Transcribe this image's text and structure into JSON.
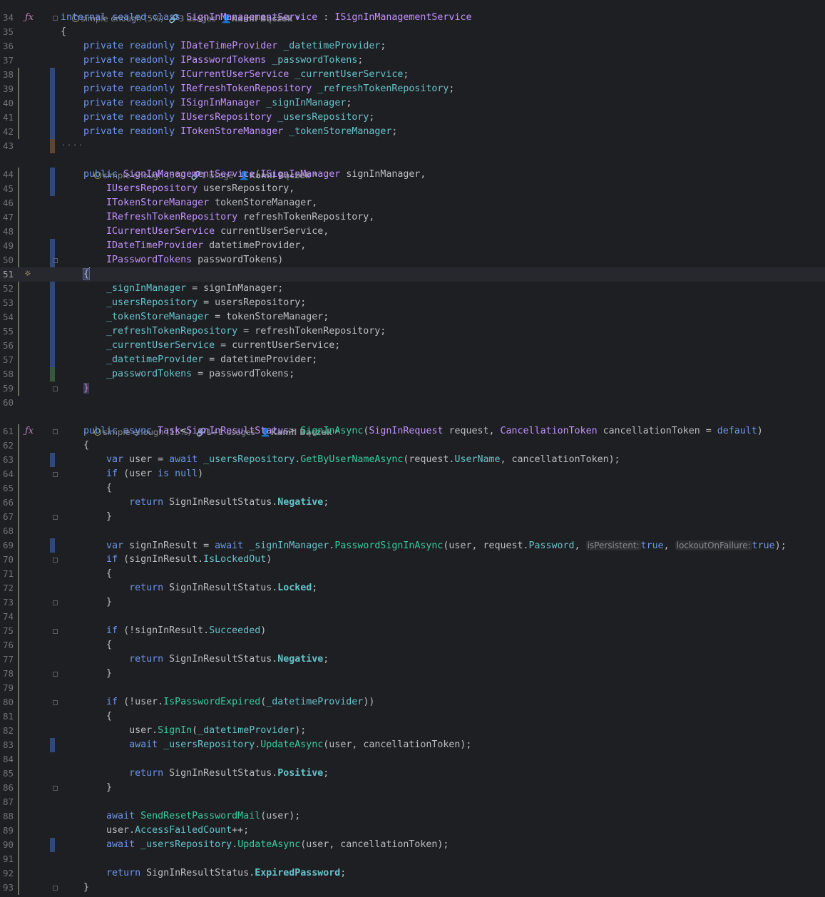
{
  "hints": {
    "class": {
      "complexity": "simple enough (5%)",
      "usages": "3 usages",
      "author": "Kamil Bączek *"
    },
    "ctor": {
      "complexity": "simple enough (5%)",
      "usages": "1 usage",
      "author": "Kamil Bączek *"
    },
    "signin": {
      "complexity": "simple enough (15%)",
      "usages": "1+1 usages",
      "author": "Kamil Bączek *"
    }
  },
  "lines": [
    {
      "n": "34",
      "html": "<span class='kw2'>internal</span> <span class='kw2'>sealed</span> <span class='kw2'>class</span> <span class='ty'>SignInManagementService</span> : <span class='ty'>ISignInManagementService</span>"
    },
    {
      "n": "35",
      "html": "{"
    },
    {
      "n": "36",
      "html": "    <span class='kw2'>private</span> <span class='kw2'>readonly</span> <span class='ty'>IDateTimeProvider</span> <span class='fld'>_datetimeProvider</span>;"
    },
    {
      "n": "37",
      "html": "    <span class='kw2'>private</span> <span class='kw2'>readonly</span> <span class='ty'>IPasswordTokens</span> <span class='fld'>_passwordTokens</span>;"
    },
    {
      "n": "38",
      "html": "    <span class='kw2'>private</span> <span class='kw2'>readonly</span> <span class='ty'>ICurrentUserService</span> <span class='fld'>_currentUserService</span>;"
    },
    {
      "n": "39",
      "html": "    <span class='kw2'>private</span> <span class='kw2'>readonly</span> <span class='ty'>IRefreshTokenRepository</span> <span class='fld'>_refreshTokenRepository</span>;"
    },
    {
      "n": "40",
      "html": "    <span class='kw2'>private</span> <span class='kw2'>readonly</span> <span class='ty'>ISignInManager</span> <span class='fld'>_signInManager</span>;"
    },
    {
      "n": "41",
      "html": "    <span class='kw2'>private</span> <span class='kw2'>readonly</span> <span class='ty'>IUsersRepository</span> <span class='fld'>_usersRepository</span>;"
    },
    {
      "n": "42",
      "html": "    <span class='kw2'>private</span> <span class='kw2'>readonly</span> <span class='ty'>ITokenStoreManager</span> <span class='fld'>_tokenStoreManager</span>;"
    },
    {
      "n": "43",
      "html": "<span class='dots'>····</span>"
    },
    {
      "n": "44",
      "html": "    <span class='kw2'>public</span> <span class='ty'>SignInManagementService</span>(<span class='ty'>ISignInManager</span> signInManager,"
    },
    {
      "n": "45",
      "html": "        <span class='ty'>IUsersRepository</span> usersRepository,"
    },
    {
      "n": "46",
      "html": "        <span class='ty'>ITokenStoreManager</span> tokenStoreManager,"
    },
    {
      "n": "47",
      "html": "        <span class='ty'>IRefreshTokenRepository</span> refreshTokenRepository,"
    },
    {
      "n": "48",
      "html": "        <span class='ty'>ICurrentUserService</span> currentUserService,"
    },
    {
      "n": "49",
      "html": "        <span class='ty'>IDateTimeProvider</span> datetimeProvider,"
    },
    {
      "n": "50",
      "html": "        <span class='ty'>IPasswordTokens</span> passwordTokens)"
    },
    {
      "n": "51",
      "html": "    <span class='brace-hl'>{</span><span class='caret'></span>"
    },
    {
      "n": "52",
      "html": "        <span class='fld'>_signInManager</span> = signInManager;"
    },
    {
      "n": "53",
      "html": "        <span class='fld'>_usersRepository</span> = usersRepository;"
    },
    {
      "n": "54",
      "html": "        <span class='fld'>_tokenStoreManager</span> = tokenStoreManager;"
    },
    {
      "n": "55",
      "html": "        <span class='fld'>_refreshTokenRepository</span> = refreshTokenRepository;"
    },
    {
      "n": "56",
      "html": "        <span class='fld'>_currentUserService</span> = currentUserService;"
    },
    {
      "n": "57",
      "html": "        <span class='fld'>_datetimeProvider</span> = datetimeProvider;"
    },
    {
      "n": "58",
      "html": "        <span class='fld'>_passwordTokens</span> = passwordTokens;"
    },
    {
      "n": "59",
      "html": "    <span class='braceclose'>}</span>"
    },
    {
      "n": "60",
      "html": ""
    },
    {
      "n": "61",
      "html": "    <span class='kw2'>public</span> <span class='kw2'>async</span> <span class='ty'>Task</span>&lt;<span class='ty'>SignInResultStatus</span>&gt; <span class='mth'>SignInAsync</span>(<span class='ty'>SignInRequest</span> request, <span class='ty'>CancellationToken</span> cancellationToken = <span class='kw2'>default</span>)"
    },
    {
      "n": "62",
      "html": "    {"
    },
    {
      "n": "63",
      "html": "        <span class='kw2'>var</span> user = <span class='kw2'>await</span> <span class='fld'>_usersRepository</span>.<span class='mth'>GetByUserNameAsync</span>(request.<span class='prop'>UserName</span>, cancellationToken);"
    },
    {
      "n": "64",
      "html": "        <span class='kw2'>if</span> (user <span class='kw2'>is</span> <span class='kw2'>null</span>)"
    },
    {
      "n": "65",
      "html": "        {"
    },
    {
      "n": "66",
      "html": "            <span class='kw2'>return</span> <span class='ty' style='color:#bcbec4'>SignInResultStatus</span>.<span class='enum'>Negative</span>;"
    },
    {
      "n": "67",
      "html": "        }"
    },
    {
      "n": "68",
      "html": ""
    },
    {
      "n": "69",
      "html": "        <span class='kw2'>var</span> signInResult = <span class='kw2'>await</span> <span class='fld'>_signInManager</span>.<span class='mth'>PasswordSignInAsync</span>(user, request.<span class='prop'>Password</span>, <span class='inlay'>isPersistent:</span><span class='kw2'>true</span>, <span class='inlay'>lockoutOnFailure:</span><span class='kw2'>true</span>);"
    },
    {
      "n": "70",
      "html": "        <span class='kw2'>if</span> (signInResult.<span class='prop'>IsLockedOut</span>)"
    },
    {
      "n": "71",
      "html": "        {"
    },
    {
      "n": "72",
      "html": "            <span class='kw2'>return</span> SignInResultStatus.<span class='enum'>Locked</span>;"
    },
    {
      "n": "73",
      "html": "        }"
    },
    {
      "n": "74",
      "html": ""
    },
    {
      "n": "75",
      "html": "        <span class='kw2'>if</span> (!signInResult.<span class='prop'>Succeeded</span>)"
    },
    {
      "n": "76",
      "html": "        {"
    },
    {
      "n": "77",
      "html": "            <span class='kw2'>return</span> SignInResultStatus.<span class='enum'>Negative</span>;"
    },
    {
      "n": "78",
      "html": "        }"
    },
    {
      "n": "79",
      "html": ""
    },
    {
      "n": "80",
      "html": "        <span class='kw2'>if</span> (!user.<span class='mth'>IsPasswordExpired</span>(<span class='fld'>_datetimeProvider</span>))"
    },
    {
      "n": "81",
      "html": "        {"
    },
    {
      "n": "82",
      "html": "            user.<span class='mth'>SignIn</span>(<span class='fld'>_datetimeProvider</span>);"
    },
    {
      "n": "83",
      "html": "            <span class='kw2'>await</span> <span class='fld'>_usersRepository</span>.<span class='mth'>UpdateAsync</span>(user, cancellationToken);"
    },
    {
      "n": "84",
      "html": ""
    },
    {
      "n": "85",
      "html": "            <span class='kw2'>return</span> SignInResultStatus.<span class='enum'>Positive</span>;"
    },
    {
      "n": "86",
      "html": "        }"
    },
    {
      "n": "87",
      "html": ""
    },
    {
      "n": "88",
      "html": "        <span class='kw2'>await</span> <span class='mth'>SendResetPasswordMail</span>(user);"
    },
    {
      "n": "89",
      "html": "        user.<span class='prop'>AccessFailedCount</span>++;"
    },
    {
      "n": "90",
      "html": "        <span class='kw2'>await</span> <span class='fld'>_usersRepository</span>.<span class='mth'>UpdateAsync</span>(user, cancellationToken);"
    },
    {
      "n": "91",
      "html": ""
    },
    {
      "n": "92",
      "html": "        <span class='kw2'>return</span> SignInResultStatus.<span class='enum'>ExpiredPassword</span>;"
    },
    {
      "n": "93",
      "html": "    }"
    }
  ]
}
